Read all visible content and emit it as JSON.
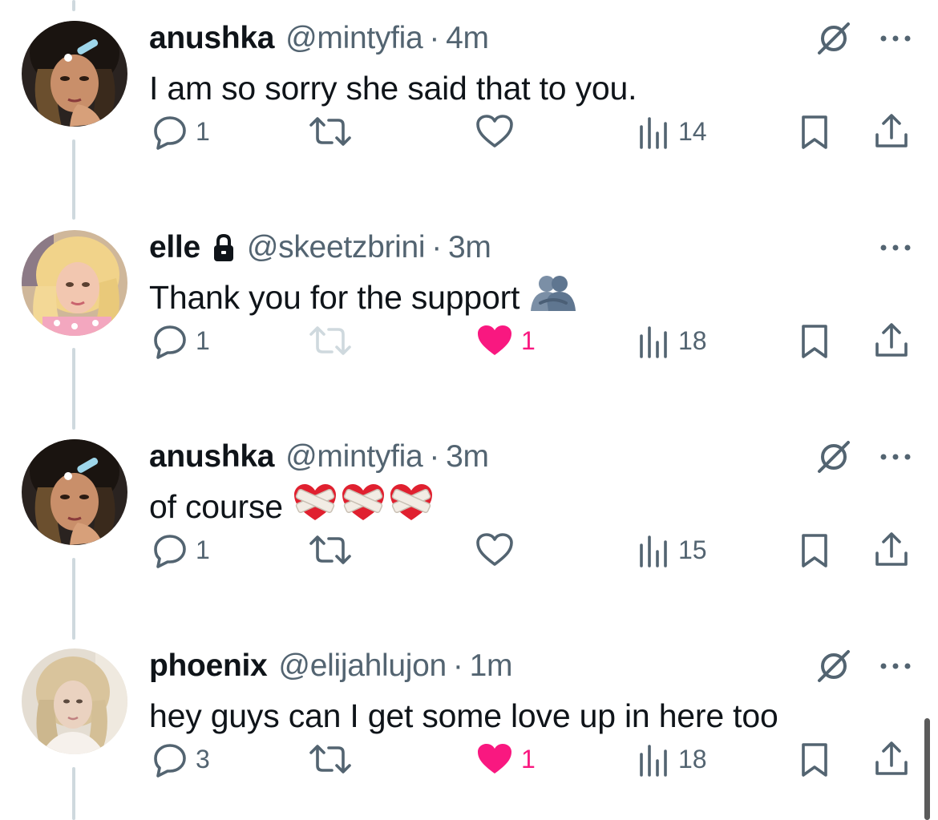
{
  "tweets": [
    {
      "name": "anushka",
      "handle": "@mintyfia",
      "time": "4m",
      "text": "I am so sorry she said that to you.",
      "emoji": "",
      "avatar": "anushka-avatar",
      "locked": false,
      "show_grok": true,
      "replies": "1",
      "reposts": "",
      "likes": "",
      "liked": false,
      "repost_disabled": false,
      "views": "14"
    },
    {
      "name": "elle",
      "handle": "@skeetzbrini",
      "time": "3m",
      "text": "Thank you for the support",
      "emoji": "people-hugging",
      "avatar": "elle-avatar",
      "locked": true,
      "show_grok": false,
      "replies": "1",
      "reposts": "",
      "likes": "1",
      "liked": true,
      "repost_disabled": true,
      "views": "18"
    },
    {
      "name": "anushka",
      "handle": "@mintyfia",
      "time": "3m",
      "text": "of course",
      "emoji": "mending-heart x3",
      "avatar": "anushka-avatar",
      "locked": false,
      "show_grok": true,
      "replies": "1",
      "reposts": "",
      "likes": "",
      "liked": false,
      "repost_disabled": false,
      "views": "15"
    },
    {
      "name": "phoenix",
      "handle": "@elijahlujon",
      "time": "1m",
      "text": "hey guys can I get some love up in here too",
      "emoji": "",
      "avatar": "phoenix-avatar",
      "locked": false,
      "show_grok": true,
      "replies": "3",
      "reposts": "",
      "likes": "1",
      "liked": true,
      "repost_disabled": false,
      "views": "18"
    }
  ],
  "separator": "·",
  "icons": {
    "reply": "reply-icon",
    "repost": "repost-icon",
    "like": "heart-icon",
    "views": "views-icon",
    "bookmark": "bookmark-icon",
    "share": "share-icon",
    "grok": "grok-icon",
    "more": "more-icon",
    "lock": "lock-icon"
  },
  "colors": {
    "text": "#0f1419",
    "secondary": "#536471",
    "like": "#f91880",
    "thread_line": "#cfd9de"
  }
}
